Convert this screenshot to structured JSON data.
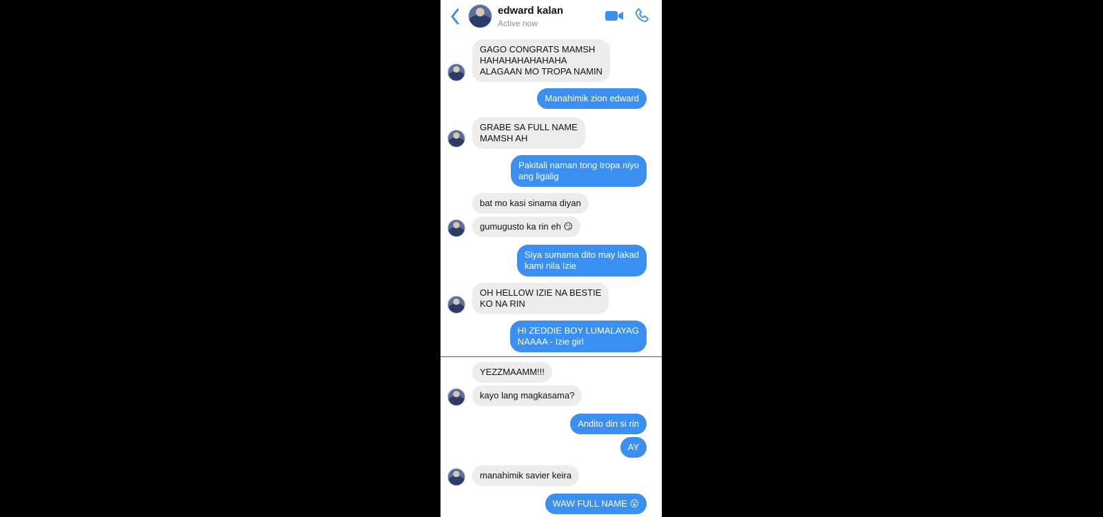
{
  "header": {
    "contact_name": "edward kalan",
    "status": "Active now",
    "accent_color": "#3a8ff0"
  },
  "messages": [
    {
      "side": "in",
      "text": "GAGO CONGRATS MAMSH\nHAHAHAHAHAHAHA\nALAGAAN MO TROPA NAMIN"
    },
    {
      "side": "out",
      "text": "Manahimik zion edward"
    },
    {
      "side": "in",
      "text": "GRABE SA FULL NAME\nMAMSH AH"
    },
    {
      "side": "out",
      "text": "Pakitali naman tong tropa niyo\nang ligalig"
    },
    {
      "side": "in",
      "text": "bat mo kasi sinama diyan"
    },
    {
      "side": "in",
      "text": "gumugusto ka rin eh 😏"
    },
    {
      "side": "out",
      "text": "Siya sumama dito may lakad\nkami nila Izie"
    },
    {
      "side": "in",
      "text": "OH HELLOW IZIE NA BESTIE\nKO NA RIN"
    },
    {
      "side": "out",
      "text": "HI ZEDDIE BOY LUMALAYAG\nNAAAA - Izie girl"
    },
    {
      "side": "in",
      "text": "YEZZMAAMM!!!"
    },
    {
      "side": "in",
      "text": "kayo lang magkasama?"
    },
    {
      "side": "out",
      "text": "Andito din si rin"
    },
    {
      "side": "out",
      "text": "AY"
    },
    {
      "side": "in",
      "text": "manahimik savier keira"
    },
    {
      "side": "out",
      "text": "WAW FULL NAME 😮"
    }
  ]
}
